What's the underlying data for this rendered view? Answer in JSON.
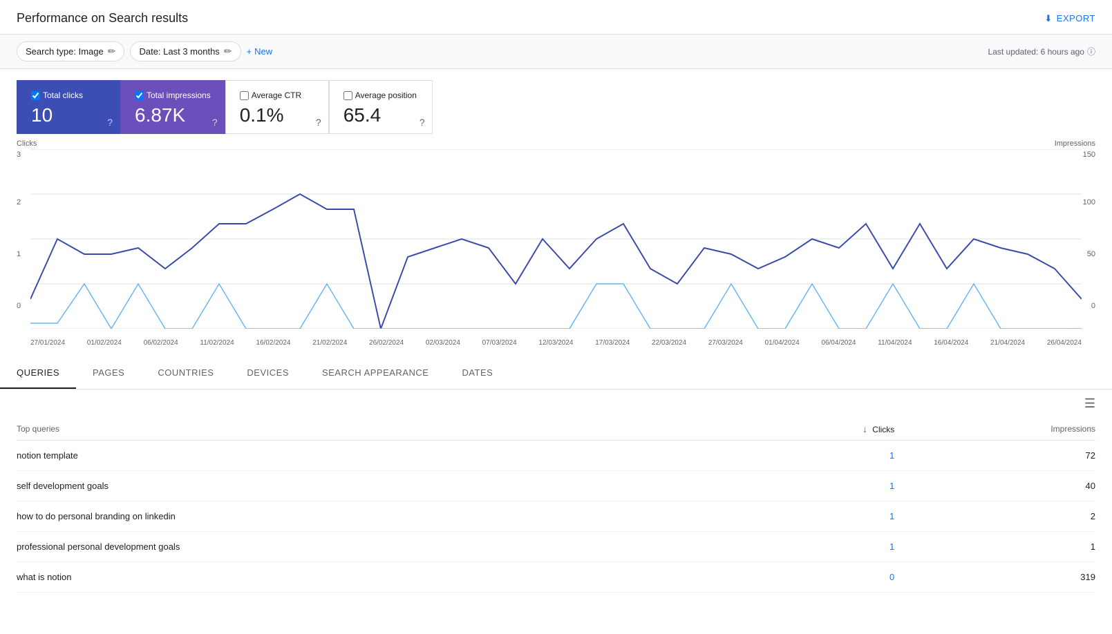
{
  "header": {
    "title": "Performance on Search results",
    "export_label": "EXPORT"
  },
  "toolbar": {
    "search_type_label": "Search type: Image",
    "date_label": "Date: Last 3 months",
    "new_label": "New",
    "last_updated": "Last updated: 6 hours ago"
  },
  "metrics": [
    {
      "id": "total-clicks",
      "label": "Total clicks",
      "value": "10",
      "active": true,
      "variant": "blue"
    },
    {
      "id": "total-impressions",
      "label": "Total impressions",
      "value": "6.87K",
      "active": true,
      "variant": "purple"
    },
    {
      "id": "average-ctr",
      "label": "Average CTR",
      "value": "0.1%",
      "active": false,
      "variant": "none"
    },
    {
      "id": "average-position",
      "label": "Average position",
      "value": "65.4",
      "active": false,
      "variant": "none"
    }
  ],
  "chart": {
    "left_label": "Clicks",
    "right_label": "Impressions",
    "left_max": "3",
    "left_mid": "2",
    "left_low": "1",
    "left_zero": "0",
    "right_max": "150",
    "right_mid": "100",
    "right_low": "50",
    "right_zero": "0",
    "dates": [
      "27/01/2024",
      "01/02/2024",
      "06/02/2024",
      "11/02/2024",
      "16/02/2024",
      "21/02/2024",
      "26/02/2024",
      "02/03/2024",
      "07/03/2024",
      "12/03/2024",
      "17/03/2024",
      "22/03/2024",
      "27/03/2024",
      "01/04/2024",
      "06/04/2024",
      "11/04/2024",
      "16/04/2024",
      "21/04/2024",
      "26/04/2024"
    ]
  },
  "tabs": [
    {
      "id": "queries",
      "label": "QUERIES",
      "active": true
    },
    {
      "id": "pages",
      "label": "PAGES",
      "active": false
    },
    {
      "id": "countries",
      "label": "COUNTRIES",
      "active": false
    },
    {
      "id": "devices",
      "label": "DEVICES",
      "active": false
    },
    {
      "id": "search-appearance",
      "label": "SEARCH APPEARANCE",
      "active": false
    },
    {
      "id": "dates",
      "label": "DATES",
      "active": false
    }
  ],
  "table": {
    "col_query": "Top queries",
    "col_clicks": "Clicks",
    "col_impressions": "Impressions",
    "rows": [
      {
        "query": "notion template",
        "clicks": "1",
        "impressions": "72"
      },
      {
        "query": "self development goals",
        "clicks": "1",
        "impressions": "40"
      },
      {
        "query": "how to do personal branding on linkedin",
        "clicks": "1",
        "impressions": "2"
      },
      {
        "query": "professional personal development goals",
        "clicks": "1",
        "impressions": "1"
      },
      {
        "query": "what is notion",
        "clicks": "0",
        "impressions": "319"
      }
    ]
  }
}
